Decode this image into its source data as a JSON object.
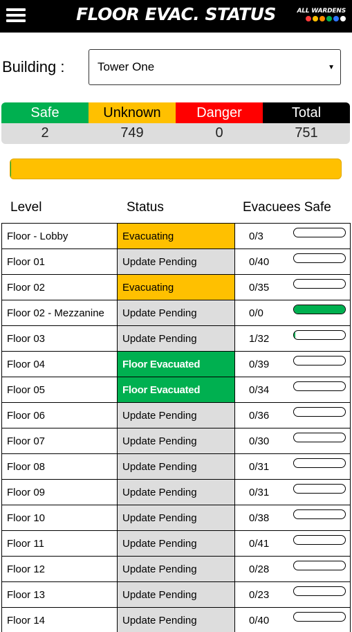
{
  "header": {
    "title": "FLOOR EVAC. STATUS",
    "logo_text": "ALL WARDENS",
    "logo_dot_colors": [
      "#ff3b3b",
      "#ffc000",
      "#ff8c00",
      "#00b050",
      "#2e75ff",
      "#ffffff"
    ]
  },
  "building": {
    "label": "Building :",
    "selected": "Tower One"
  },
  "summary": {
    "safe_label": "Safe",
    "unknown_label": "Unknown",
    "danger_label": "Danger",
    "total_label": "Total",
    "safe": "2",
    "unknown": "749",
    "danger": "0",
    "total": "751",
    "colors": {
      "safe": "#00b050",
      "unknown": "#ffc000",
      "danger": "#ff0000",
      "total": "#000000"
    }
  },
  "overall_progress": {
    "safe_fraction": 0.003
  },
  "table": {
    "headers": {
      "level": "Level",
      "status": "Status",
      "evacuees": "Evacuees Safe"
    },
    "rows": [
      {
        "level": "Floor - Lobby",
        "status": "Evacuating",
        "state": "evac",
        "count": "0/3",
        "fraction": 0
      },
      {
        "level": "Floor 01",
        "status": "Update Pending",
        "state": "pending",
        "count": "0/40",
        "fraction": 0
      },
      {
        "level": "Floor 02",
        "status": "Evacuating",
        "state": "evac",
        "count": "0/35",
        "fraction": 0
      },
      {
        "level": "Floor 02 - Mezzanine",
        "status": "Update Pending",
        "state": "pending",
        "count": "0/0",
        "fraction": 1
      },
      {
        "level": "Floor 03",
        "status": "Update Pending",
        "state": "pending",
        "count": "1/32",
        "fraction": 0.03
      },
      {
        "level": "Floor 04",
        "status": "Floor Evacuated",
        "state": "done",
        "count": "0/39",
        "fraction": 0
      },
      {
        "level": "Floor 05",
        "status": "Floor Evacuated",
        "state": "done",
        "count": "0/34",
        "fraction": 0
      },
      {
        "level": "Floor 06",
        "status": "Update Pending",
        "state": "pending",
        "count": "0/36",
        "fraction": 0
      },
      {
        "level": "Floor 07",
        "status": "Update Pending",
        "state": "pending",
        "count": "0/30",
        "fraction": 0
      },
      {
        "level": "Floor 08",
        "status": "Update Pending",
        "state": "pending",
        "count": "0/31",
        "fraction": 0
      },
      {
        "level": "Floor 09",
        "status": "Update Pending",
        "state": "pending",
        "count": "0/31",
        "fraction": 0
      },
      {
        "level": "Floor 10",
        "status": "Update Pending",
        "state": "pending",
        "count": "0/38",
        "fraction": 0
      },
      {
        "level": "Floor 11",
        "status": "Update Pending",
        "state": "pending",
        "count": "0/41",
        "fraction": 0
      },
      {
        "level": "Floor 12",
        "status": "Update Pending",
        "state": "pending",
        "count": "0/28",
        "fraction": 0
      },
      {
        "level": "Floor 13",
        "status": "Update Pending",
        "state": "pending",
        "count": "0/23",
        "fraction": 0
      },
      {
        "level": "Floor 14",
        "status": "Update Pending",
        "state": "pending",
        "count": "0/40",
        "fraction": 0
      }
    ]
  }
}
